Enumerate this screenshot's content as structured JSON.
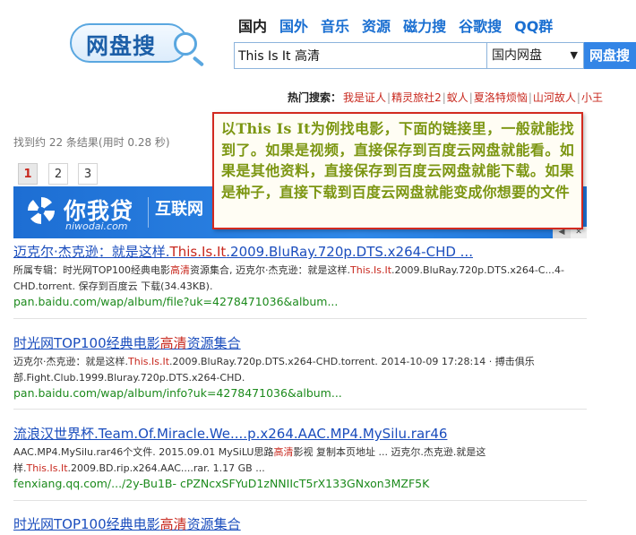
{
  "logo": {
    "text": "网盘搜"
  },
  "nav": [
    "国内",
    "国外",
    "音乐",
    "资源",
    "磁力搜",
    "谷歌搜",
    "QQ群"
  ],
  "search": {
    "value": "This Is It 高清",
    "scope": "国内网盘",
    "button": "网盘搜"
  },
  "hot": {
    "label": "热门搜索：",
    "items": [
      "我是证人",
      "精灵旅社2",
      "蚁人",
      "夏洛特烦恼",
      "山河故人",
      "小王"
    ]
  },
  "result_count": "找到约 22 条结果(用时 0.28 秒)",
  "pagination": [
    "1",
    "2",
    "3"
  ],
  "ad": {
    "brand": "你我贷",
    "domain": "niwodai.com",
    "tagline": "互联网"
  },
  "notice": "以This Is It为例找电影，下面的链接里，一般就能找到了。如果是视频，直接保存到百度云网盘就能看。如果是其他资料，直接保存到百度云网盘就能下载。如果是种子，直接下载到百度云网盘就能变成你想要的文件",
  "results": [
    {
      "title_pre": "迈克尔·杰克逊：就是这样.",
      "title_hl": "This.Is.It",
      "title_post": ".2009.BluRay.720p.DTS.x264-CHD ...",
      "desc_pre": "所属专辑：时光网TOP100经典电影",
      "desc_hl1": "高清",
      "desc_mid": "资源集合, 迈克尔·杰克逊：就是这样.",
      "desc_hl2": "This.Is.It",
      "desc_post": ".2009.BluRay.720p.DTS.x264-C...4-CHD.torrent. 保存到百度云 下载(34.43KB).",
      "url": "pan.baidu.com/wap/album/file?uk=4278471036&album..."
    },
    {
      "title_pre": "时光网TOP100经典电影",
      "title_hl": "高清",
      "title_post": "资源集合",
      "desc_pre": "迈克尔·杰克逊：就是这样.",
      "desc_hl1": "This.Is.It",
      "desc_mid": ".2009.BluRay.720p.DTS.x264-CHD.torrent. 2014-10-09 17:28:14 · 搏击俱乐部.Fight.Club.1999.Bluray.720p.DTS.x264-CHD.",
      "desc_hl2": "",
      "desc_post": "",
      "url": "pan.baidu.com/wap/album/info?uk=4278471036&album..."
    },
    {
      "title_pre": "流浪汉世界杯.Team.Of.Miracle.We....p.x264.AAC.MP4.MySilu.rar46",
      "title_hl": "",
      "title_post": "",
      "desc_pre": "AAC.MP4.MySilu.rar46个文件. 2015.09.01 MySiLU思路",
      "desc_hl1": "高清",
      "desc_mid": "影视 复制本页地址 ... 迈克尔.杰克逊.就是这样.",
      "desc_hl2": "This.Is.It",
      "desc_post": ".2009.BD.rip.x264.AAC....rar. 1.17 GB ...",
      "url": "fenxiang.qq.com/.../2y-Bu1B- cPZNcxSFYuD1zNNIIcT5rX133GNxon3MZF5K"
    },
    {
      "title_pre": "时光网TOP100经典电影",
      "title_hl": "高清",
      "title_post": "资源集合"
    }
  ]
}
